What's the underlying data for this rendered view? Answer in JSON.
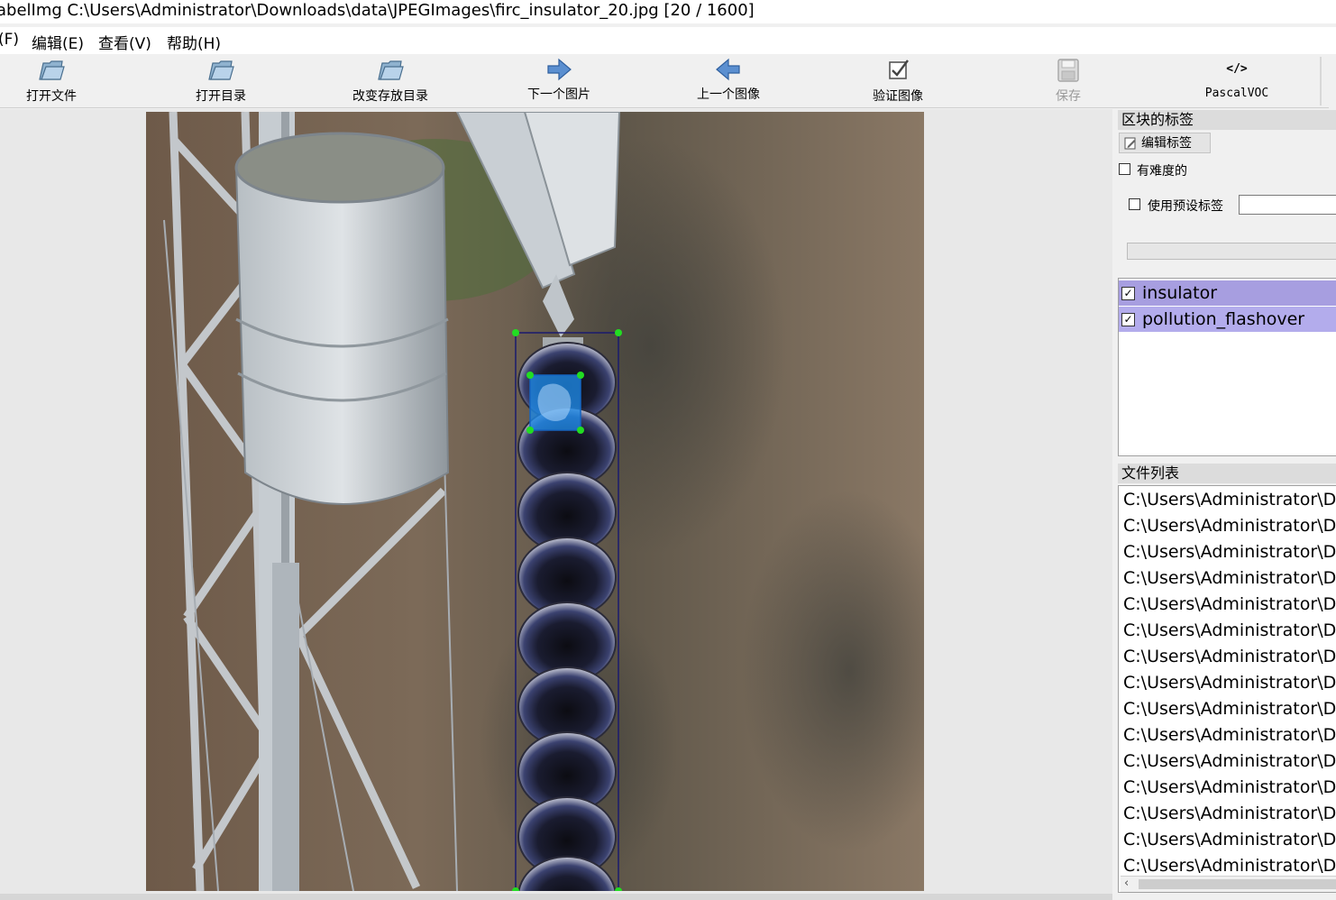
{
  "window": {
    "title": "abelImg C:\\Users\\Administrator\\Downloads\\data\\JPEGImages\\firc_insulator_20.jpg [20 / 1600]"
  },
  "menu": {
    "items": [
      "(F)",
      "编辑(E)",
      "查看(V)",
      "帮助(H)"
    ]
  },
  "toolbar": {
    "open_file": "打开文件",
    "open_dir": "打开目录",
    "change_save_dir": "改变存放目录",
    "next_image": "下一个图片",
    "prev_image": "上一个图像",
    "verify_image": "验证图像",
    "save": "保存",
    "format": "PascalVOC",
    "format_icon_text": "</>"
  },
  "box_labels_panel": {
    "title": "区块的标签",
    "edit_label_button": "编辑标签",
    "difficult_label": "有难度的",
    "difficult_checked": false,
    "use_default_label": "使用预设标签",
    "use_default_checked": false,
    "default_label_value": "",
    "labels": [
      {
        "text": "insulator",
        "checked": true,
        "color": "#a79ee0"
      },
      {
        "text": "pollution_flashover",
        "checked": true,
        "color": "#b3acec"
      }
    ]
  },
  "file_list_panel": {
    "title": "文件列表",
    "files": [
      "C:\\Users\\Administrator\\D",
      "C:\\Users\\Administrator\\D",
      "C:\\Users\\Administrator\\D",
      "C:\\Users\\Administrator\\D",
      "C:\\Users\\Administrator\\D",
      "C:\\Users\\Administrator\\D",
      "C:\\Users\\Administrator\\D",
      "C:\\Users\\Administrator\\D",
      "C:\\Users\\Administrator\\D",
      "C:\\Users\\Administrator\\D",
      "C:\\Users\\Administrator\\D",
      "C:\\Users\\Administrator\\D",
      "C:\\Users\\Administrator\\D",
      "C:\\Users\\Administrator\\D",
      "C:\\Users\\Administrator\\D"
    ]
  },
  "canvas": {
    "annotations": [
      {
        "label": "insulator",
        "color": "#1a1a6e"
      },
      {
        "label": "pollution_flashover",
        "color": "#1e88e5"
      }
    ],
    "handle_color": "#22dd22"
  }
}
